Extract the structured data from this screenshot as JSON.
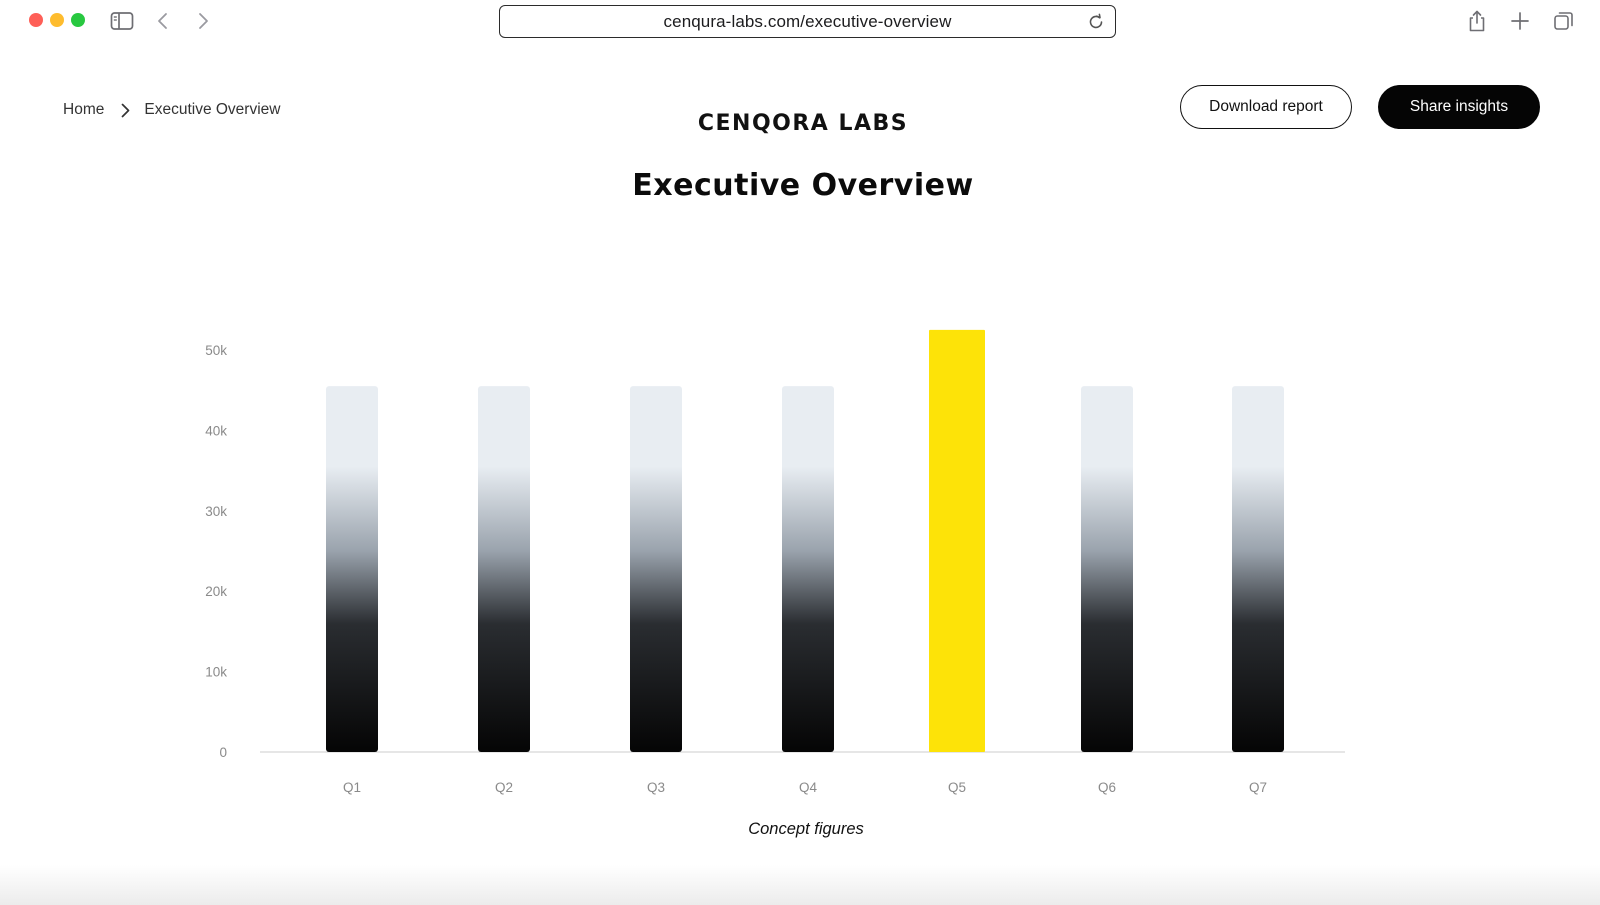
{
  "browser": {
    "url": "cenqura-labs.com/executive-overview"
  },
  "breadcrumb": {
    "home": "Home",
    "current": "Executive Overview"
  },
  "header": {
    "brand": "CENQORA LABS",
    "title": "Executive Overview",
    "download_label": "Download report",
    "share_label": "Share insights"
  },
  "chart_data": {
    "type": "bar",
    "categories": [
      "Q1",
      "Q2",
      "Q3",
      "Q4",
      "Q5",
      "Q6",
      "Q7"
    ],
    "values": [
      45500,
      45500,
      45500,
      45500,
      52500,
      45500,
      45500
    ],
    "highlight_index": 4,
    "highlight_color": "#fde308",
    "bar_gradient": [
      "#e8edf2",
      "#9aa3ad",
      "#2a2d31",
      "#050505"
    ],
    "y_ticks": [
      "0",
      "10k",
      "20k",
      "30k",
      "40k",
      "50k"
    ],
    "ylim": [
      0,
      52500
    ],
    "xlabel": "",
    "ylabel": "",
    "grid": false,
    "caption": "Concept figures"
  }
}
